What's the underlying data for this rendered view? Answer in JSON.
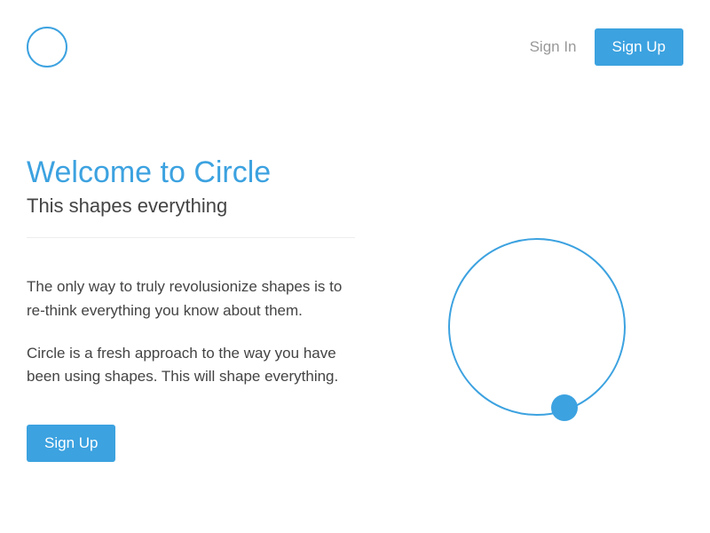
{
  "header": {
    "signin_label": "Sign In",
    "signup_label": "Sign Up"
  },
  "hero": {
    "title": "Welcome to Circle",
    "subtitle": "This shapes everything",
    "paragraph1": "The only way to truly revolusionize shapes is to re-think everything you know about them.",
    "paragraph2": "Circle is a fresh approach to the way you have been using shapes. This will shape everything.",
    "cta_label": "Sign Up"
  }
}
